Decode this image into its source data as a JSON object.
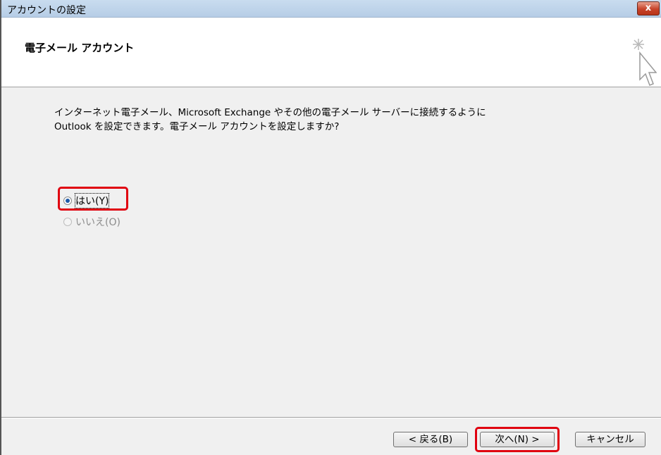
{
  "window": {
    "title": "アカウントの設定",
    "close_label": "x"
  },
  "header": {
    "title": "電子メール アカウント"
  },
  "main": {
    "description_line1": "インターネット電子メール、Microsoft Exchange やその他の電子メール サーバーに接続するように",
    "description_line2": "Outlook を設定できます。電子メール アカウントを設定しますか?",
    "options": [
      {
        "label": "はい(Y)",
        "checked": true,
        "enabled": true
      },
      {
        "label": "いいえ(O)",
        "checked": false,
        "enabled": false
      }
    ]
  },
  "footer": {
    "back_label": "< 戻る(B)",
    "next_label": "次へ(N) >",
    "cancel_label": "キャンセル"
  },
  "colors": {
    "highlight": "#e0000f",
    "radio_dot": "#1d5aa8"
  }
}
